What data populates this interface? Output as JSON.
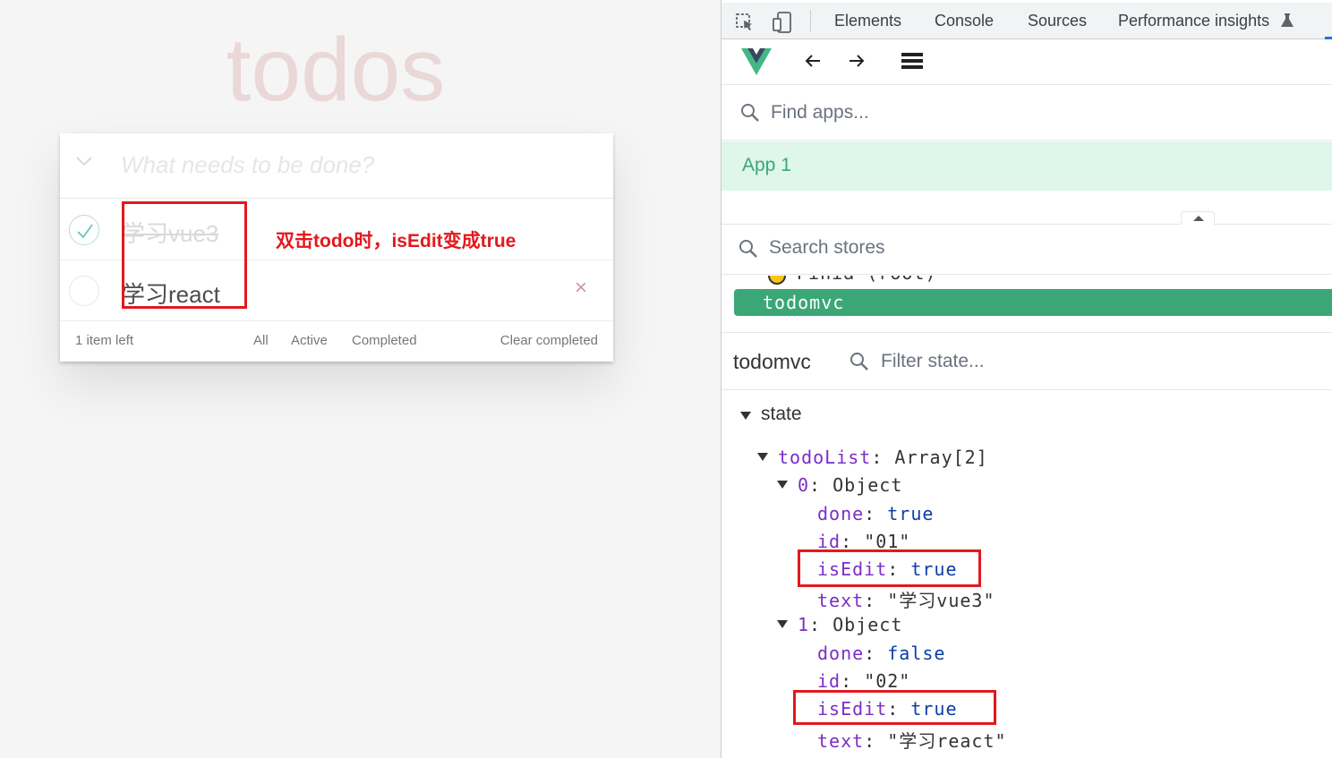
{
  "todo_app": {
    "title": "todos",
    "new_todo_placeholder": "What needs to be done?",
    "todos": [
      {
        "text": "学习vue3",
        "done": true
      },
      {
        "text": "学习react",
        "done": false
      }
    ],
    "destroy_glyph": "×",
    "footer": {
      "count": "1 item left",
      "filter_all": "All",
      "filter_active": "Active",
      "filter_completed": "Completed",
      "clear": "Clear completed"
    },
    "annotation": "双击todo时，isEdit变成true",
    "annotation_color": "#e3181d"
  },
  "devtools": {
    "tabs": [
      "Elements",
      "Console",
      "Sources",
      "Performance insights"
    ],
    "find_apps_placeholder": "Find apps...",
    "app_name": "App 1",
    "search_stores_placeholder": "Search stores",
    "root_store": "Pinia (root)",
    "selected_store": "todomvc",
    "inspector_store": "todomvc",
    "filter_state_placeholder": "Filter state...",
    "state_label": "state",
    "tree": {
      "todoList_key": "todoList",
      "todoList_type": "Array[2]",
      "items": [
        {
          "index": "0",
          "type": "Object",
          "done": "true",
          "id": "\"01\"",
          "isEdit": "true",
          "text": "\"学习vue3\""
        },
        {
          "index": "1",
          "type": "Object",
          "done": "false",
          "id": "\"02\"",
          "isEdit": "true",
          "text": "\"学习react\""
        }
      ]
    },
    "accent_color": "#3ba776"
  }
}
